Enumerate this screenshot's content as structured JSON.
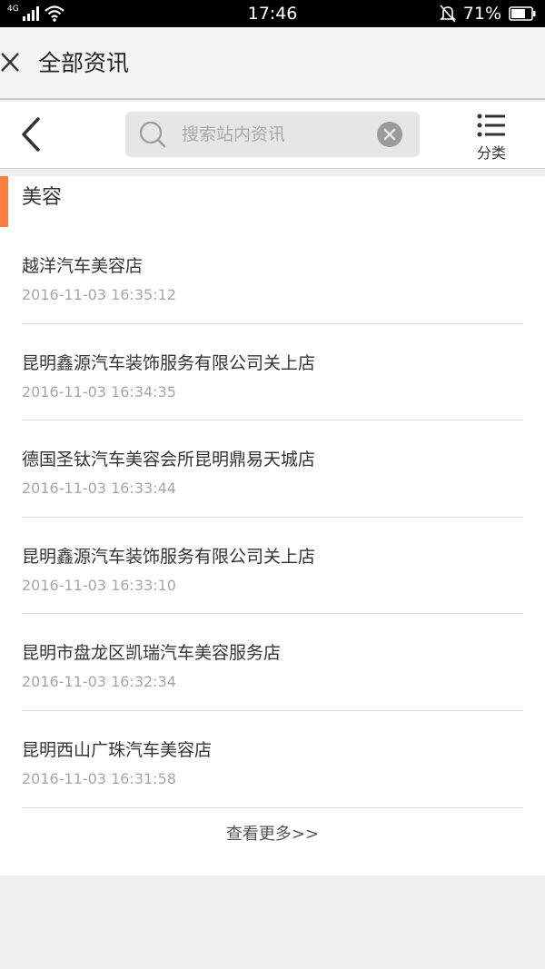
{
  "status_bar": {
    "network": "4G",
    "time": "17:46",
    "battery": "71%",
    "icons": [
      "signal-icon",
      "wifi-icon",
      "bell-muted-icon",
      "battery-icon"
    ]
  },
  "header": {
    "title": "全部资讯"
  },
  "toolbar": {
    "search_placeholder": "搜索站内资讯",
    "search_value": "",
    "category_label": "分类"
  },
  "section": {
    "title": "美容",
    "accent_color": "#ff7f41"
  },
  "news": [
    {
      "title": "越洋汽车美容店",
      "time": "2016-11-03 16:35:12"
    },
    {
      "title": "昆明鑫源汽车装饰服务有限公司关上店",
      "time": "2016-11-03 16:34:35"
    },
    {
      "title": "德国圣钛汽车美容会所昆明鼎易天城店",
      "time": "2016-11-03 16:33:44"
    },
    {
      "title": "昆明鑫源汽车装饰服务有限公司关上店",
      "time": "2016-11-03 16:33:10"
    },
    {
      "title": "昆明市盘龙区凯瑞汽车美容服务店",
      "time": "2016-11-03 16:32:34"
    },
    {
      "title": "昆明西山广珠汽车美容店",
      "time": "2016-11-03 16:31:58"
    }
  ],
  "more_label": "查看更多>>"
}
